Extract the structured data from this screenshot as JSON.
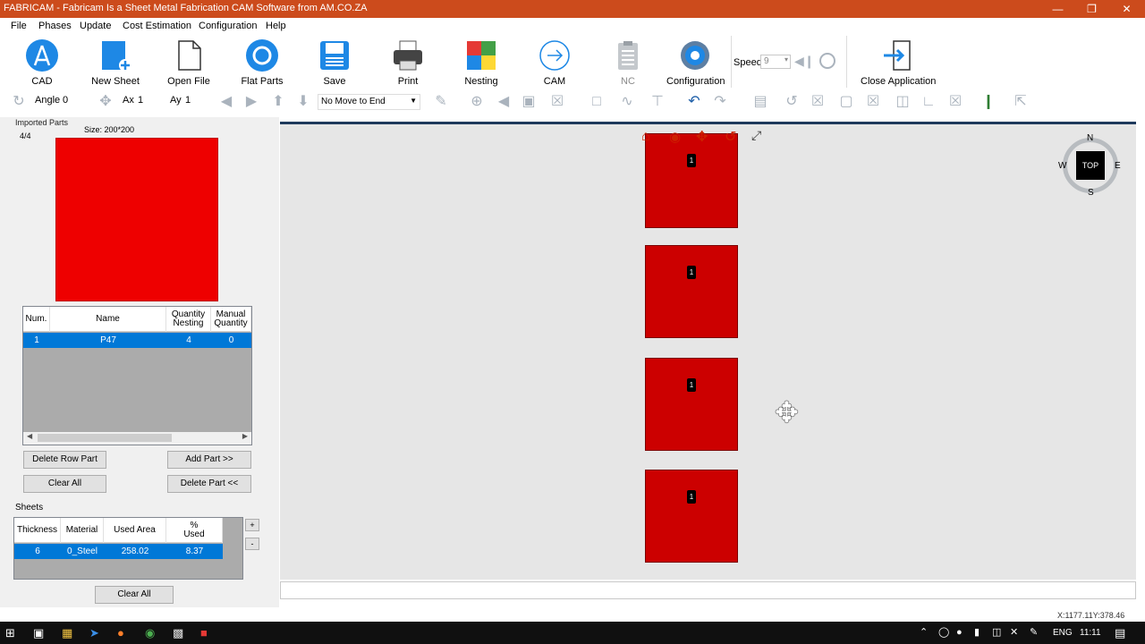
{
  "window": {
    "title": "FABRICAM - Fabricam Is a Sheet Metal Fabrication CAM Software from AM.CO.ZA"
  },
  "menu": [
    "File",
    "Phases",
    "Update",
    "Cost Estimation",
    "Configuration",
    "Help"
  ],
  "toolbar": {
    "cad": "CAD",
    "new_sheet": "New Sheet",
    "open_file": "Open File",
    "flat_parts": "Flat Parts",
    "save": "Save",
    "print": "Print",
    "nesting": "Nesting",
    "cam": "CAM",
    "nc": "NC",
    "configuration": "Configuration",
    "speed_label": "Speed",
    "speed_value": "9",
    "close_app": "Close Application"
  },
  "toolbar2": {
    "angle_label": "Angle",
    "angle_value": "0",
    "ax_label": "Ax",
    "ax_value": "1",
    "ay_label": "Ay",
    "ay_value": "1",
    "move_select": "No Move to End"
  },
  "imported": {
    "title": "Imported Parts",
    "count": "4/4",
    "size": "Size: 200*200"
  },
  "parts_table": {
    "headers": {
      "num": "Num.",
      "name": "Name",
      "qn1": "Quantity",
      "qn2": "Nesting",
      "mq1": "Manual",
      "mq2": "Quantity"
    },
    "rows": [
      {
        "num": "1",
        "name": "P47",
        "qty_nesting": "4",
        "manual_qty": "0"
      }
    ]
  },
  "buttons": {
    "delete_row": "Delete Row Part",
    "add_part": "Add Part >>",
    "clear_all": "Clear All",
    "delete_part": "Delete Part <<",
    "sheets_clear": "Clear All",
    "plus": "+",
    "minus": "-"
  },
  "sheets": {
    "title": "Sheets",
    "headers": {
      "thickness": "Thickness",
      "material": "Material",
      "used_area": "Used Area",
      "pct1": "%",
      "pct2": "Used"
    },
    "rows": [
      {
        "thickness": "6",
        "material": "0_Steel",
        "used_area": "258.02",
        "pct_used": "8.37"
      }
    ]
  },
  "canvas": {
    "part_labels": [
      "1",
      "1",
      "1",
      "1"
    ],
    "compass": {
      "n": "N",
      "s": "S",
      "e": "E",
      "w": "W",
      "center": "TOP"
    }
  },
  "status": {
    "coords": "X:1177.11Y:378.46"
  },
  "taskbar": {
    "lang": "ENG",
    "time": "11:11"
  },
  "colors": {
    "titlebar": "#cc4b1c",
    "part": "#cc0000",
    "selection": "#0078d7"
  }
}
